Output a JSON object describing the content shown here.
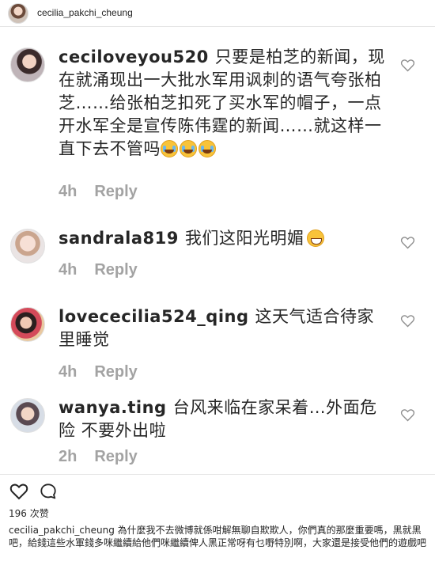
{
  "header": {
    "username": "cecilia_pakchi_cheung"
  },
  "comments": [
    {
      "username": "ceciloveyou520",
      "text": "只要是柏芝的新闻，现在就涌现出一大批水军用讽刺的语气夸张柏芝……给张柏芝扣死了买水军的帽子，一点开水军全是宣传陈伟霆的新闻……就这样一直下去不管吗",
      "emojis": [
        "loudly-crying-face",
        "loudly-crying-face",
        "loudly-crying-face"
      ],
      "time": "4h",
      "reply_label": "Reply"
    },
    {
      "username": "sandrala819",
      "text": "我们这阳光明媚",
      "emojis": [
        "grinning-face"
      ],
      "time": "4h",
      "reply_label": "Reply"
    },
    {
      "username": "lovececilia524_qing",
      "text": "这天气适合待家里睡觉",
      "emojis": [],
      "time": "4h",
      "reply_label": "Reply"
    },
    {
      "username": "wanya.ting",
      "text": "台风来临在家呆着…外面危险 不要外出啦",
      "emojis": [],
      "time": "2h",
      "reply_label": "Reply"
    }
  ],
  "actions": {
    "like_icon": "heart-outline-icon",
    "comment_icon": "comment-bubble-icon"
  },
  "likes": {
    "count": "196",
    "label": "次赞"
  },
  "caption": {
    "username": "cecilia_pakchi_cheung",
    "text": "為什麼我不去微博就係咁解無聊自欺欺人，你們真的那麼重要嗎，黑就黑吧，給錢這些水軍錢多咪繼續給他們咪繼續俾人黑正常呀有乜嘢特別啊，大家還是接受他們的遊戲吧"
  }
}
